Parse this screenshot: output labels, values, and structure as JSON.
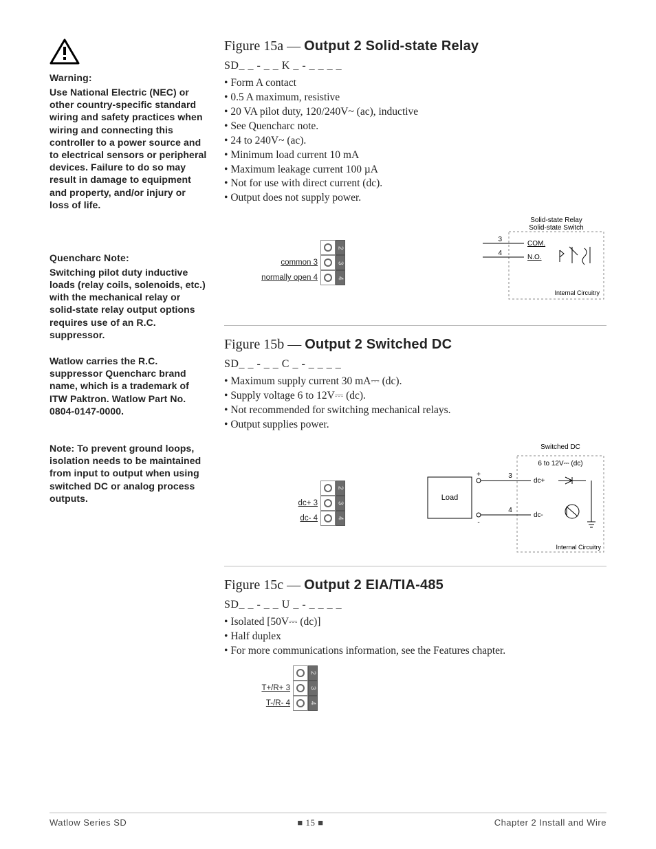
{
  "sidebar": {
    "warning_title": "Warning:",
    "warning_body": "Use National Electric (NEC) or other country-specific standard wiring and safety practices when wiring and connecting this controller to a power source and to electrical sensors or peripheral devices. Failure to do so may result in damage to equipment and property, and/or injury or loss of life.",
    "quencharc_title": "Quencharc Note:",
    "quencharc_body": "Switching pilot duty inductive loads (relay coils, solenoids, etc.) with the mechanical relay or solid-state relay output options requires use of an R.C. suppressor.",
    "watlow_body": "Watlow carries the R.C. suppressor Quencharc brand name, which is a trademark of ITW Paktron. Watlow Part No. 0804-0147-0000.",
    "note_body": "Note: To prevent ground loops, isolation needs to be maintained from input to output when using switched DC or analog process outputs."
  },
  "figures": {
    "a": {
      "lead": "Figure 15a — ",
      "title": "Output 2 Solid-state Relay",
      "partno": "SD_  _  -  _  _  K  _  -  _  _  _  _",
      "bullets": [
        "Form A contact",
        "0.5 A maximum, resistive",
        "20 VA pilot duty, 120/240V~ (ac), inductive",
        "See Quencharc note.",
        "24 to 240V~ (ac).",
        "Minimum load current 10 mA",
        "Maximum leakage current 100 µA",
        "Not for use with direct current (dc).",
        "Output does not supply power."
      ],
      "block_labels": {
        "r1": "",
        "r2": "common  3",
        "r3": "normally open  4"
      },
      "schem": {
        "title1": "Solid-state Relay",
        "title2": "Solid-state Switch",
        "l3": "3",
        "l3t": "COM.",
        "l4": "4",
        "l4t": "N.O.",
        "foot": "Internal Circuitry"
      }
    },
    "b": {
      "lead": "Figure 15b — ",
      "title": "Output 2 Switched DC",
      "partno": "SD_  _  -  _  _  C  _  -  _  _  _  _",
      "bullets": [
        "Maximum supply current 30 mA⎓ (dc).",
        "Supply voltage 6 to 12V⎓ (dc).",
        "Not recommended for switching mechanical relays.",
        "Output supplies power."
      ],
      "block_labels": {
        "r1": "",
        "r2": "dc+  3",
        "r3": "dc-   4"
      },
      "schem": {
        "title1": "Switched DC",
        "title2": "6 to 12V⎓ (dc)",
        "l3": "3",
        "l3t": "dc+",
        "l4": "4",
        "l4t": "dc-",
        "load": "Load",
        "plus": "+",
        "minus": "-",
        "foot": "Internal Circuitry"
      }
    },
    "c": {
      "lead": "Figure 15c — ",
      "title": "Output 2 EIA/TIA-485",
      "partno": "SD_  _  -  _  _  U  _  -  _  _  _  _",
      "bullets": [
        "Isolated [50V⎓ (dc)]",
        "Half duplex",
        "For more communications information, see the Features chapter."
      ],
      "block_labels": {
        "r1": "",
        "r2": "T+/R+   3",
        "r3": "T-/R-     4"
      }
    }
  },
  "footer": {
    "left": "Watlow Series SD",
    "mid": "■   15   ■",
    "right": "Chapter 2 Install and Wire"
  }
}
